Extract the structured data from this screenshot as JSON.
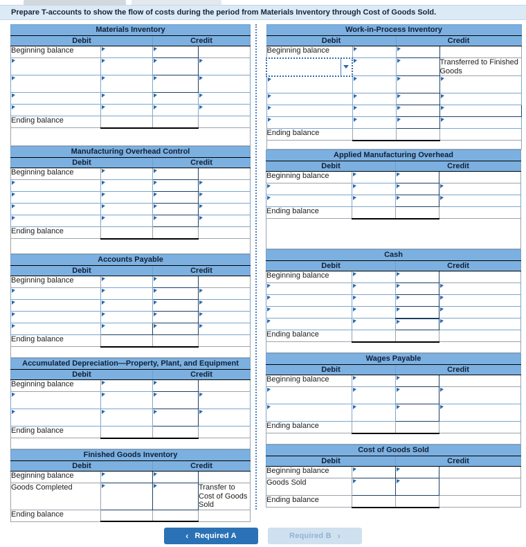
{
  "banner": {
    "instruction": "Prepare T-accounts to show the flow of costs during the period from Materials Inventory through Cost of Goods Sold."
  },
  "headers": {
    "debit": "Debit",
    "credit": "Credit"
  },
  "labels": {
    "beginning_balance": "Beginning balance",
    "ending_balance": "Ending balance",
    "goods_completed": "Goods Completed",
    "goods_sold": "Goods Sold",
    "transferred_to_finished_goods": "Transferred to Finished Goods",
    "transfer_to_cost_of_goods_sold": "Transfer to Cost of Goods Sold"
  },
  "accounts": {
    "materials_inventory": {
      "title": "Materials Inventory"
    },
    "work_in_process": {
      "title": "Work-in-Process Inventory"
    },
    "manufacturing_overhead_control": {
      "title": "Manufacturing Overhead Control"
    },
    "applied_manufacturing_overhead": {
      "title": "Applied Manufacturing Overhead"
    },
    "accounts_payable": {
      "title": "Accounts Payable"
    },
    "cash": {
      "title": "Cash"
    },
    "accumulated_depreciation": {
      "title": "Accumulated Depreciation—Property, Plant, and Equipment"
    },
    "wages_payable": {
      "title": "Wages Payable"
    },
    "finished_goods_inventory": {
      "title": "Finished Goods Inventory"
    },
    "cost_of_goods_sold": {
      "title": "Cost of Goods Sold"
    }
  },
  "footer": {
    "prev_label": "Required A",
    "next_label": "Required B",
    "prev_chevron": "‹",
    "next_chevron": "›"
  },
  "colors": {
    "header_blue": "#7cb0e0",
    "banner_blue": "#dceaf6",
    "input_border": "#7ca6cd",
    "accent_blue": "#2a72b5",
    "disabled_blue": "#cfe0ef"
  }
}
